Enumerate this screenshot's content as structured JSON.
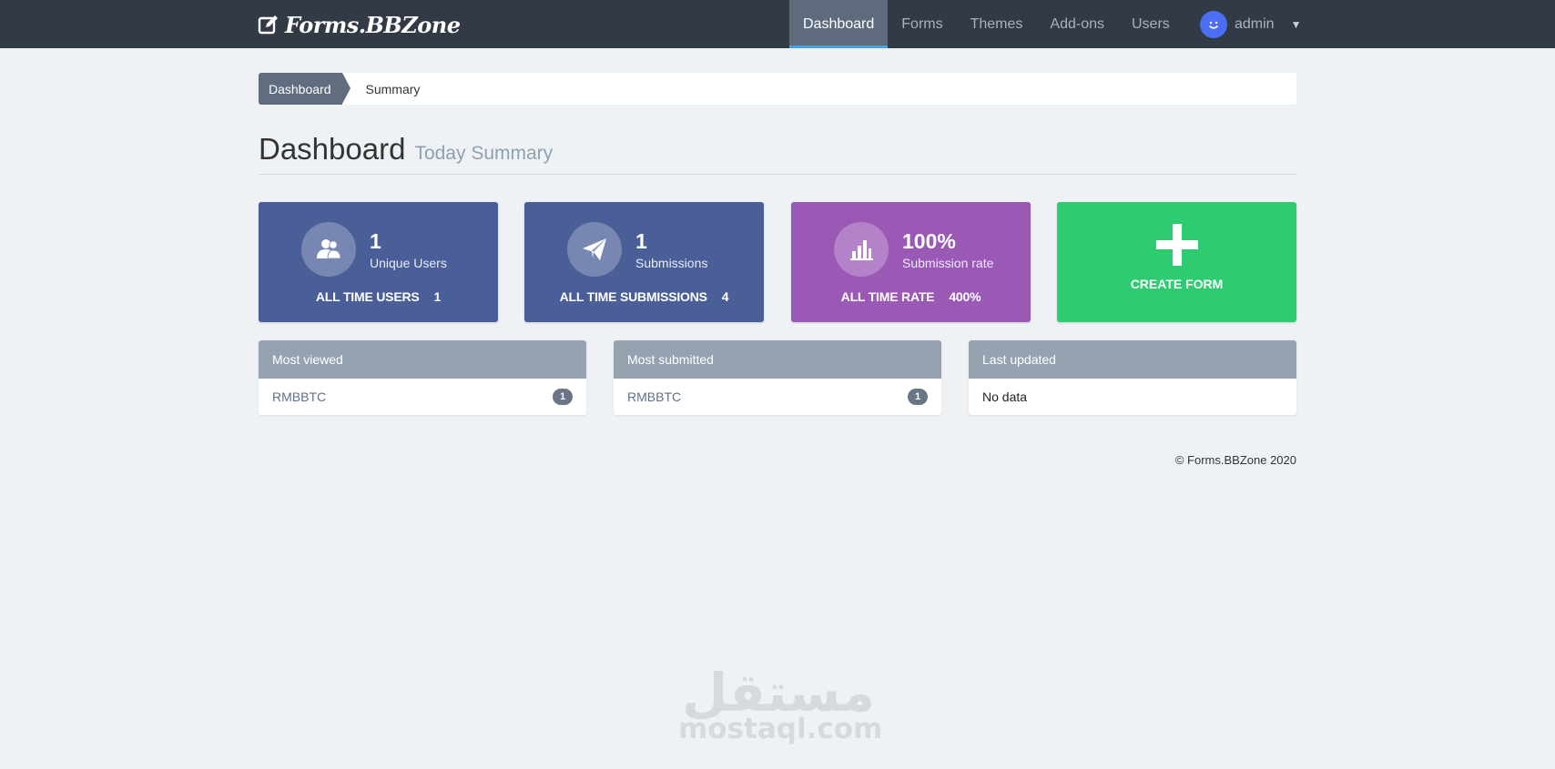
{
  "brand": {
    "name": "Forms.BBZone",
    "icon": "edit-icon"
  },
  "nav": {
    "items": [
      {
        "label": "Dashboard",
        "active": true
      },
      {
        "label": "Forms",
        "active": false
      },
      {
        "label": "Themes",
        "active": false
      },
      {
        "label": "Add-ons",
        "active": false
      },
      {
        "label": "Users",
        "active": false
      }
    ],
    "user": {
      "name": "admin",
      "avatar_icon": "smiley-icon",
      "caret_icon": "caret-down-icon"
    }
  },
  "breadcrumb": {
    "active": "Dashboard",
    "current": "Summary"
  },
  "page": {
    "title": "Dashboard",
    "subtitle": "Today Summary"
  },
  "cards": [
    {
      "icon": "users-icon",
      "value": "1",
      "label": "Unique Users",
      "foot_label": "ALL TIME USERS",
      "foot_value": "1",
      "color": "#4a5f98"
    },
    {
      "icon": "paper-plane-icon",
      "value": "1",
      "label": "Submissions",
      "foot_label": "ALL TIME SUBMISSIONS",
      "foot_value": "4",
      "color": "#4a5f98"
    },
    {
      "icon": "bar-chart-icon",
      "value": "100%",
      "label": "Submission rate",
      "foot_label": "ALL TIME RATE",
      "foot_value": "400%",
      "color": "#9b59b6"
    },
    {
      "icon": "plus-icon",
      "label": "CREATE FORM",
      "color": "#2ecc71"
    }
  ],
  "panels": [
    {
      "title": "Most viewed",
      "rows": [
        {
          "name": "RMBBTC",
          "count": "1"
        }
      ]
    },
    {
      "title": "Most submitted",
      "rows": [
        {
          "name": "RMBBTC",
          "count": "1"
        }
      ]
    },
    {
      "title": "Last updated",
      "empty_text": "No data"
    }
  ],
  "footer": {
    "copyright": "© Forms.BBZone 2020"
  },
  "watermark": {
    "arabic": "مستقل",
    "latin": "mostaql.com"
  }
}
